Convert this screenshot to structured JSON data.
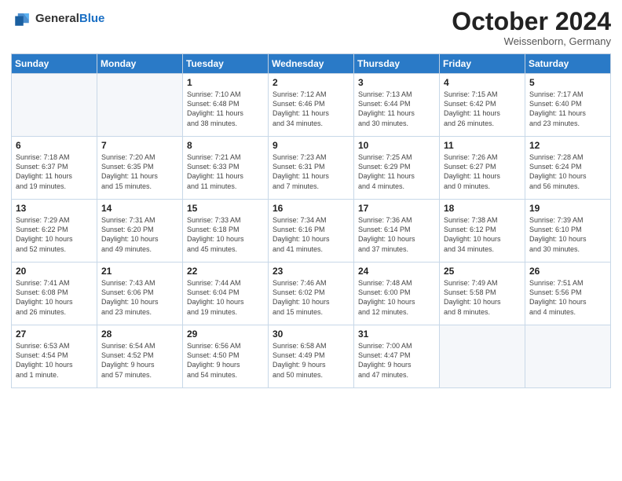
{
  "header": {
    "logo_line1": "General",
    "logo_line2": "Blue",
    "month": "October 2024",
    "location": "Weissenborn, Germany"
  },
  "days_of_week": [
    "Sunday",
    "Monday",
    "Tuesday",
    "Wednesday",
    "Thursday",
    "Friday",
    "Saturday"
  ],
  "weeks": [
    [
      {
        "day": "",
        "info": ""
      },
      {
        "day": "",
        "info": ""
      },
      {
        "day": "1",
        "info": "Sunrise: 7:10 AM\nSunset: 6:48 PM\nDaylight: 11 hours\nand 38 minutes."
      },
      {
        "day": "2",
        "info": "Sunrise: 7:12 AM\nSunset: 6:46 PM\nDaylight: 11 hours\nand 34 minutes."
      },
      {
        "day": "3",
        "info": "Sunrise: 7:13 AM\nSunset: 6:44 PM\nDaylight: 11 hours\nand 30 minutes."
      },
      {
        "day": "4",
        "info": "Sunrise: 7:15 AM\nSunset: 6:42 PM\nDaylight: 11 hours\nand 26 minutes."
      },
      {
        "day": "5",
        "info": "Sunrise: 7:17 AM\nSunset: 6:40 PM\nDaylight: 11 hours\nand 23 minutes."
      }
    ],
    [
      {
        "day": "6",
        "info": "Sunrise: 7:18 AM\nSunset: 6:37 PM\nDaylight: 11 hours\nand 19 minutes."
      },
      {
        "day": "7",
        "info": "Sunrise: 7:20 AM\nSunset: 6:35 PM\nDaylight: 11 hours\nand 15 minutes."
      },
      {
        "day": "8",
        "info": "Sunrise: 7:21 AM\nSunset: 6:33 PM\nDaylight: 11 hours\nand 11 minutes."
      },
      {
        "day": "9",
        "info": "Sunrise: 7:23 AM\nSunset: 6:31 PM\nDaylight: 11 hours\nand 7 minutes."
      },
      {
        "day": "10",
        "info": "Sunrise: 7:25 AM\nSunset: 6:29 PM\nDaylight: 11 hours\nand 4 minutes."
      },
      {
        "day": "11",
        "info": "Sunrise: 7:26 AM\nSunset: 6:27 PM\nDaylight: 11 hours\nand 0 minutes."
      },
      {
        "day": "12",
        "info": "Sunrise: 7:28 AM\nSunset: 6:24 PM\nDaylight: 10 hours\nand 56 minutes."
      }
    ],
    [
      {
        "day": "13",
        "info": "Sunrise: 7:29 AM\nSunset: 6:22 PM\nDaylight: 10 hours\nand 52 minutes."
      },
      {
        "day": "14",
        "info": "Sunrise: 7:31 AM\nSunset: 6:20 PM\nDaylight: 10 hours\nand 49 minutes."
      },
      {
        "day": "15",
        "info": "Sunrise: 7:33 AM\nSunset: 6:18 PM\nDaylight: 10 hours\nand 45 minutes."
      },
      {
        "day": "16",
        "info": "Sunrise: 7:34 AM\nSunset: 6:16 PM\nDaylight: 10 hours\nand 41 minutes."
      },
      {
        "day": "17",
        "info": "Sunrise: 7:36 AM\nSunset: 6:14 PM\nDaylight: 10 hours\nand 37 minutes."
      },
      {
        "day": "18",
        "info": "Sunrise: 7:38 AM\nSunset: 6:12 PM\nDaylight: 10 hours\nand 34 minutes."
      },
      {
        "day": "19",
        "info": "Sunrise: 7:39 AM\nSunset: 6:10 PM\nDaylight: 10 hours\nand 30 minutes."
      }
    ],
    [
      {
        "day": "20",
        "info": "Sunrise: 7:41 AM\nSunset: 6:08 PM\nDaylight: 10 hours\nand 26 minutes."
      },
      {
        "day": "21",
        "info": "Sunrise: 7:43 AM\nSunset: 6:06 PM\nDaylight: 10 hours\nand 23 minutes."
      },
      {
        "day": "22",
        "info": "Sunrise: 7:44 AM\nSunset: 6:04 PM\nDaylight: 10 hours\nand 19 minutes."
      },
      {
        "day": "23",
        "info": "Sunrise: 7:46 AM\nSunset: 6:02 PM\nDaylight: 10 hours\nand 15 minutes."
      },
      {
        "day": "24",
        "info": "Sunrise: 7:48 AM\nSunset: 6:00 PM\nDaylight: 10 hours\nand 12 minutes."
      },
      {
        "day": "25",
        "info": "Sunrise: 7:49 AM\nSunset: 5:58 PM\nDaylight: 10 hours\nand 8 minutes."
      },
      {
        "day": "26",
        "info": "Sunrise: 7:51 AM\nSunset: 5:56 PM\nDaylight: 10 hours\nand 4 minutes."
      }
    ],
    [
      {
        "day": "27",
        "info": "Sunrise: 6:53 AM\nSunset: 4:54 PM\nDaylight: 10 hours\nand 1 minute."
      },
      {
        "day": "28",
        "info": "Sunrise: 6:54 AM\nSunset: 4:52 PM\nDaylight: 9 hours\nand 57 minutes."
      },
      {
        "day": "29",
        "info": "Sunrise: 6:56 AM\nSunset: 4:50 PM\nDaylight: 9 hours\nand 54 minutes."
      },
      {
        "day": "30",
        "info": "Sunrise: 6:58 AM\nSunset: 4:49 PM\nDaylight: 9 hours\nand 50 minutes."
      },
      {
        "day": "31",
        "info": "Sunrise: 7:00 AM\nSunset: 4:47 PM\nDaylight: 9 hours\nand 47 minutes."
      },
      {
        "day": "",
        "info": ""
      },
      {
        "day": "",
        "info": ""
      }
    ]
  ]
}
